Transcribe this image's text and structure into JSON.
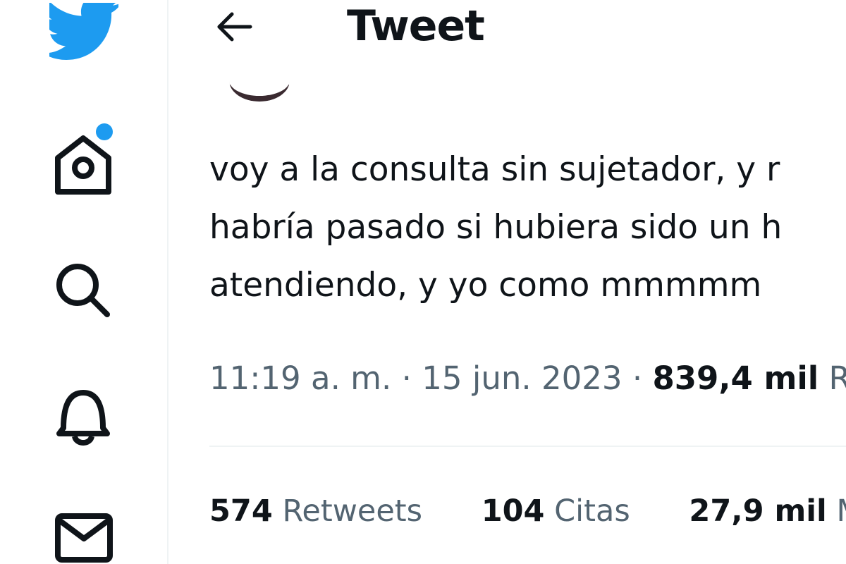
{
  "sidebar": {
    "icons": [
      "twitter-logo-icon",
      "home-icon",
      "search-icon",
      "bell-icon",
      "mail-icon"
    ],
    "accent_color": "#1d9bf0",
    "home_notification_dot": true
  },
  "header": {
    "title": "Tweet",
    "back_icon": "arrow-left-icon"
  },
  "tweet": {
    "lines": [
      "voy a la consulta sin sujetador, y r",
      "habría pasado si hubiera sido un h",
      "atendiendo, y yo como mmmmm"
    ],
    "time": "11:19 a. m.",
    "separator": "·",
    "date": "15 jun. 2023",
    "views_count": "839,4 mil",
    "views_label": "Re"
  },
  "stats": {
    "retweets_count": "574",
    "retweets_label": "Retweets",
    "quotes_count": "104",
    "quotes_label": "Citas",
    "likes_count": "27,9 mil",
    "likes_label": "Me"
  }
}
